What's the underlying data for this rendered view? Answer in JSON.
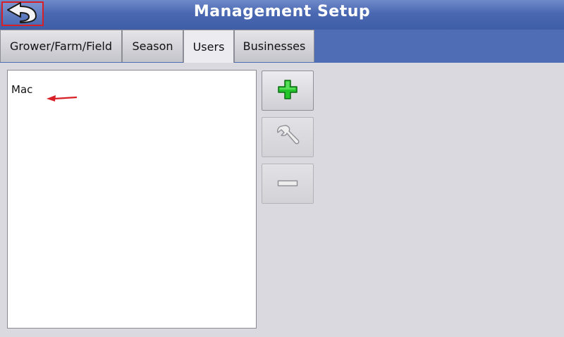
{
  "header": {
    "title": "Management Setup",
    "back_icon": "back-arrow-icon"
  },
  "tabs": [
    {
      "label": "Grower/Farm/Field",
      "active": false
    },
    {
      "label": "Season",
      "active": false
    },
    {
      "label": "Users",
      "active": true
    },
    {
      "label": "Businesses",
      "active": false
    }
  ],
  "users_list": {
    "items": [
      "Mac"
    ]
  },
  "actions": {
    "add_icon": "plus-icon",
    "edit_icon": "wrench-icon",
    "remove_icon": "minus-icon"
  },
  "colors": {
    "accent_green": "#1fbf1f",
    "highlight_red": "#d81f26",
    "header_blue": "#4a68b2"
  }
}
